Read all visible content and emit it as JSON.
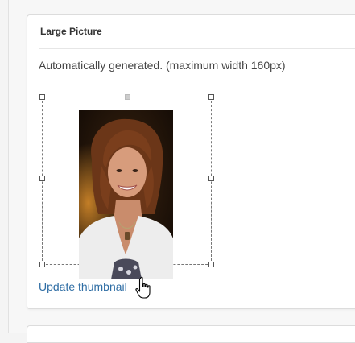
{
  "card": {
    "title": "Large Picture",
    "helper_text": "Automatically generated. (maximum width 160px)",
    "link_label": "Update thumbnail"
  },
  "image": {
    "subject": "profile-photo"
  },
  "cursor": {
    "icon": "hand-pointer-icon"
  },
  "colors": {
    "link": "#2e6da4",
    "title": "#333333",
    "text": "#444444"
  }
}
